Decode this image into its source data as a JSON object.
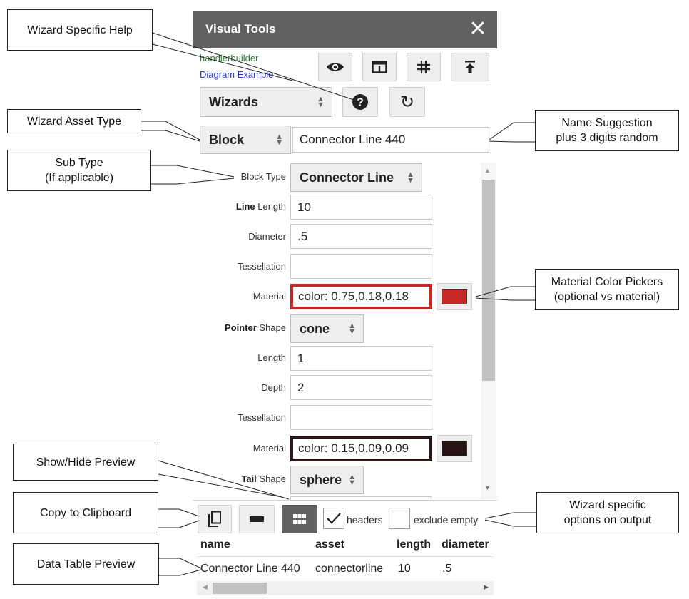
{
  "window": {
    "title": "Visual Tools",
    "close_glyph": "✕"
  },
  "links": {
    "partial": "handlerbuilder",
    "diagram": "Diagram Example"
  },
  "toolbar_icons": [
    "eye-icon",
    "preview-panel-icon",
    "grid-icon",
    "upload-icon"
  ],
  "wizard_select": {
    "value": "Wizards"
  },
  "help": {
    "glyph": "?"
  },
  "refresh": {
    "glyph": "↻"
  },
  "asset_type": {
    "value": "Block"
  },
  "asset_name": {
    "value": "Connector Line 440"
  },
  "form": {
    "block_type": {
      "label": "Block Type",
      "value": "Connector Line"
    },
    "line_length": {
      "label_bold": "Line",
      "label_rest": " Length",
      "value": "10"
    },
    "diameter": {
      "label": "Diameter",
      "value": ".5"
    },
    "tessellation": {
      "label": "Tessellation",
      "value": ""
    },
    "material": {
      "label": "Material",
      "value": "color: 0.75,0.18,0.18",
      "swatch": "#c62828"
    },
    "pointer_shape": {
      "label_bold": "Pointer",
      "label_rest": " Shape",
      "value": "cone"
    },
    "pointer_length": {
      "label": "Length",
      "value": "1"
    },
    "pointer_depth": {
      "label": "Depth",
      "value": "2"
    },
    "pointer_tessellation": {
      "label": "Tessellation",
      "value": ""
    },
    "pointer_material": {
      "label": "Material",
      "value": "color: 0.15,0.09,0.09",
      "swatch": "#261414"
    },
    "tail_shape": {
      "label_bold": "Tail",
      "label_rest": " Shape",
      "value": "sphere"
    }
  },
  "output_bar": {
    "headers_label": "headers",
    "headers_checked": true,
    "exclude_label": "exclude empty",
    "exclude_checked": false
  },
  "table": {
    "columns": [
      "name",
      "asset",
      "length",
      "diameter"
    ],
    "rows": [
      [
        "Connector Line 440",
        "connectorline",
        "10",
        ".5"
      ]
    ]
  },
  "callouts": {
    "help": "Wizard Specific Help",
    "asset_type": "Wizard Asset Type",
    "sub_type_1": "Sub Type",
    "sub_type_2": "(If applicable)",
    "name_1": "Name Suggestion",
    "name_2": "plus 3 digits random",
    "material_1": "Material Color Pickers",
    "material_2": "(optional vs material)",
    "preview": "Show/Hide Preview",
    "clipboard": "Copy to Clipboard",
    "options_1": "Wizard specific",
    "options_2": "options on output",
    "table": "Data Table Preview"
  },
  "colors": {
    "titlebar": "#616161",
    "accent_red": "#c62828",
    "accent_dark": "#261414",
    "link_green": "#2e7d32",
    "link_blue": "#2b35d6"
  }
}
